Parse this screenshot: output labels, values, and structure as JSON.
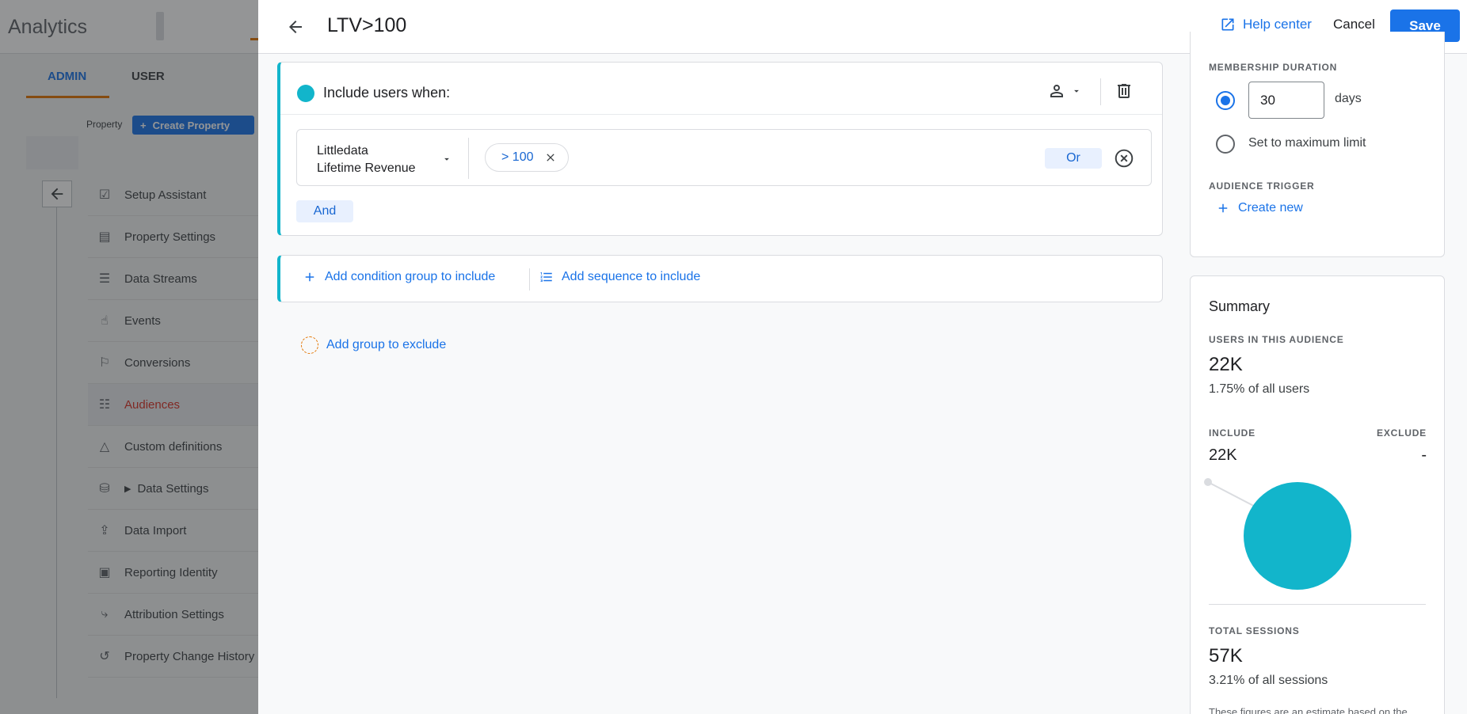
{
  "background": {
    "app_title": "Analytics",
    "tabs": [
      "ADMIN",
      "USER"
    ],
    "property_label": "Property",
    "create_property": "Create Property",
    "nav": [
      {
        "label": "Setup Assistant",
        "icon": "checkbox-icon"
      },
      {
        "label": "Property Settings",
        "icon": "layout-icon"
      },
      {
        "label": "Data Streams",
        "icon": "streams-icon"
      },
      {
        "label": "Events",
        "icon": "touch-icon"
      },
      {
        "label": "Conversions",
        "icon": "flag-icon"
      },
      {
        "label": "Audiences",
        "icon": "audience-icon",
        "active": true
      },
      {
        "label": "Custom definitions",
        "icon": "shapes-icon"
      },
      {
        "label": "Data Settings",
        "icon": "database-icon"
      },
      {
        "label": "Data Import",
        "icon": "upload-icon"
      },
      {
        "label": "Reporting Identity",
        "icon": "identity-icon"
      },
      {
        "label": "Attribution Settings",
        "icon": "attribution-icon"
      },
      {
        "label": "Property Change History",
        "icon": "history-icon"
      }
    ]
  },
  "header": {
    "title": "LTV>100",
    "help_center": "Help center",
    "cancel": "Cancel",
    "save": "Save"
  },
  "include_group": {
    "label": "Include users when:",
    "condition": {
      "dimension_line1": "Littledata",
      "dimension_line2": "Lifetime Revenue",
      "filter_value": "> 100",
      "or_label": "Or"
    },
    "and_label": "And"
  },
  "add_actions": {
    "condition_group": "Add condition group to include",
    "sequence": "Add sequence to include",
    "exclude": "Add group to exclude"
  },
  "membership": {
    "duration_label": "MEMBERSHIP DURATION",
    "days_value": "30",
    "days_unit": "days",
    "max_label": "Set to maximum limit",
    "trigger_label": "AUDIENCE TRIGGER",
    "create_new": "Create new"
  },
  "summary": {
    "title": "Summary",
    "users_label": "USERS IN THIS AUDIENCE",
    "users_value": "22K",
    "users_pct": "1.75% of all users",
    "include_label": "INCLUDE",
    "exclude_label": "EXCLUDE",
    "include_value": "22K",
    "exclude_value": "-",
    "sessions_label": "TOTAL SESSIONS",
    "sessions_value": "57K",
    "sessions_pct": "3.21% of all sessions",
    "note": "These figures are an estimate based on the"
  },
  "colors": {
    "accent": "#1a73e8",
    "include": "#12b5cb",
    "exclude_ring": "#e37400"
  }
}
